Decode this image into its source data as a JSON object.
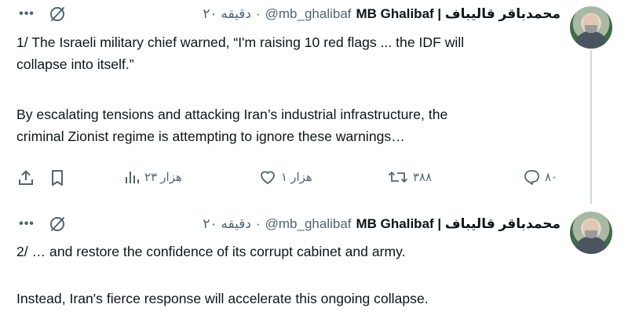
{
  "tweets": [
    {
      "display_name": "MB Ghalibaf | محمدباقر قالیباف",
      "handle": "@mb_ghalibaf",
      "separator": "·",
      "time_ago": "۲۰ دقیقه",
      "line1": "1/ The Israeli military chief warned, “I'm raising 10 red flags ... the IDF will",
      "line2": "collapse into itself.”",
      "line3": "By escalating tensions and attacking Iran’s industrial infrastructure, the",
      "line4": "criminal Zionist regime is attempting to ignore these warnings…",
      "actions": {
        "replies": "۸۰",
        "retweets": "۳۸۸",
        "likes": "۱ هزار",
        "views": "۲۳ هزار"
      }
    },
    {
      "display_name": "MB Ghalibaf | محمدباقر قالیباف",
      "handle": "@mb_ghalibaf",
      "separator": "·",
      "time_ago": "۲۰ دقیقه",
      "line1": "2/ … and restore the confidence of its corrupt cabinet and army.",
      "line2": "Instead, Iran's fierce response will accelerate this ongoing collapse."
    }
  ],
  "icons": {
    "more": "more-icon",
    "grok": "grok-icon",
    "reply": "reply-icon",
    "retweet": "retweet-icon",
    "like": "heart-icon",
    "views": "views-icon",
    "bookmark": "bookmark-icon",
    "share": "share-icon"
  },
  "colors": {
    "text": "#0f1419",
    "secondary": "#536471",
    "thread_line": "#cfd9de"
  }
}
